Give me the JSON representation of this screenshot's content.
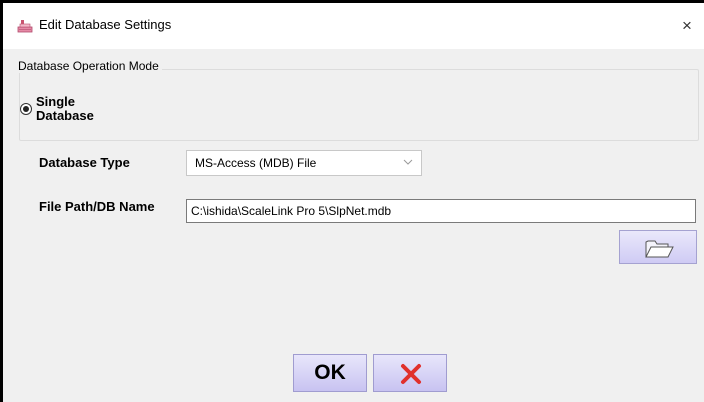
{
  "window": {
    "title": "Edit Database Settings",
    "close_glyph": "×"
  },
  "group": {
    "legend": "Database Operation Mode",
    "radio_label": "Single Database",
    "radio_checked": true
  },
  "fields": {
    "db_type_label": "Database Type",
    "db_type_value": "MS-Access (MDB) File",
    "file_path_label": "File Path/DB Name",
    "file_path_value": "C:\\ishida\\ScaleLink Pro 5\\SlpNet.mdb"
  },
  "buttons": {
    "ok_label": "OK",
    "browse_icon": "folder-icon",
    "cancel_icon": "red-x-icon"
  },
  "colors": {
    "button_gradient_top": "#e8e6fb",
    "button_gradient_bottom": "#c8c3f1",
    "cancel_x": "#e0302c"
  }
}
